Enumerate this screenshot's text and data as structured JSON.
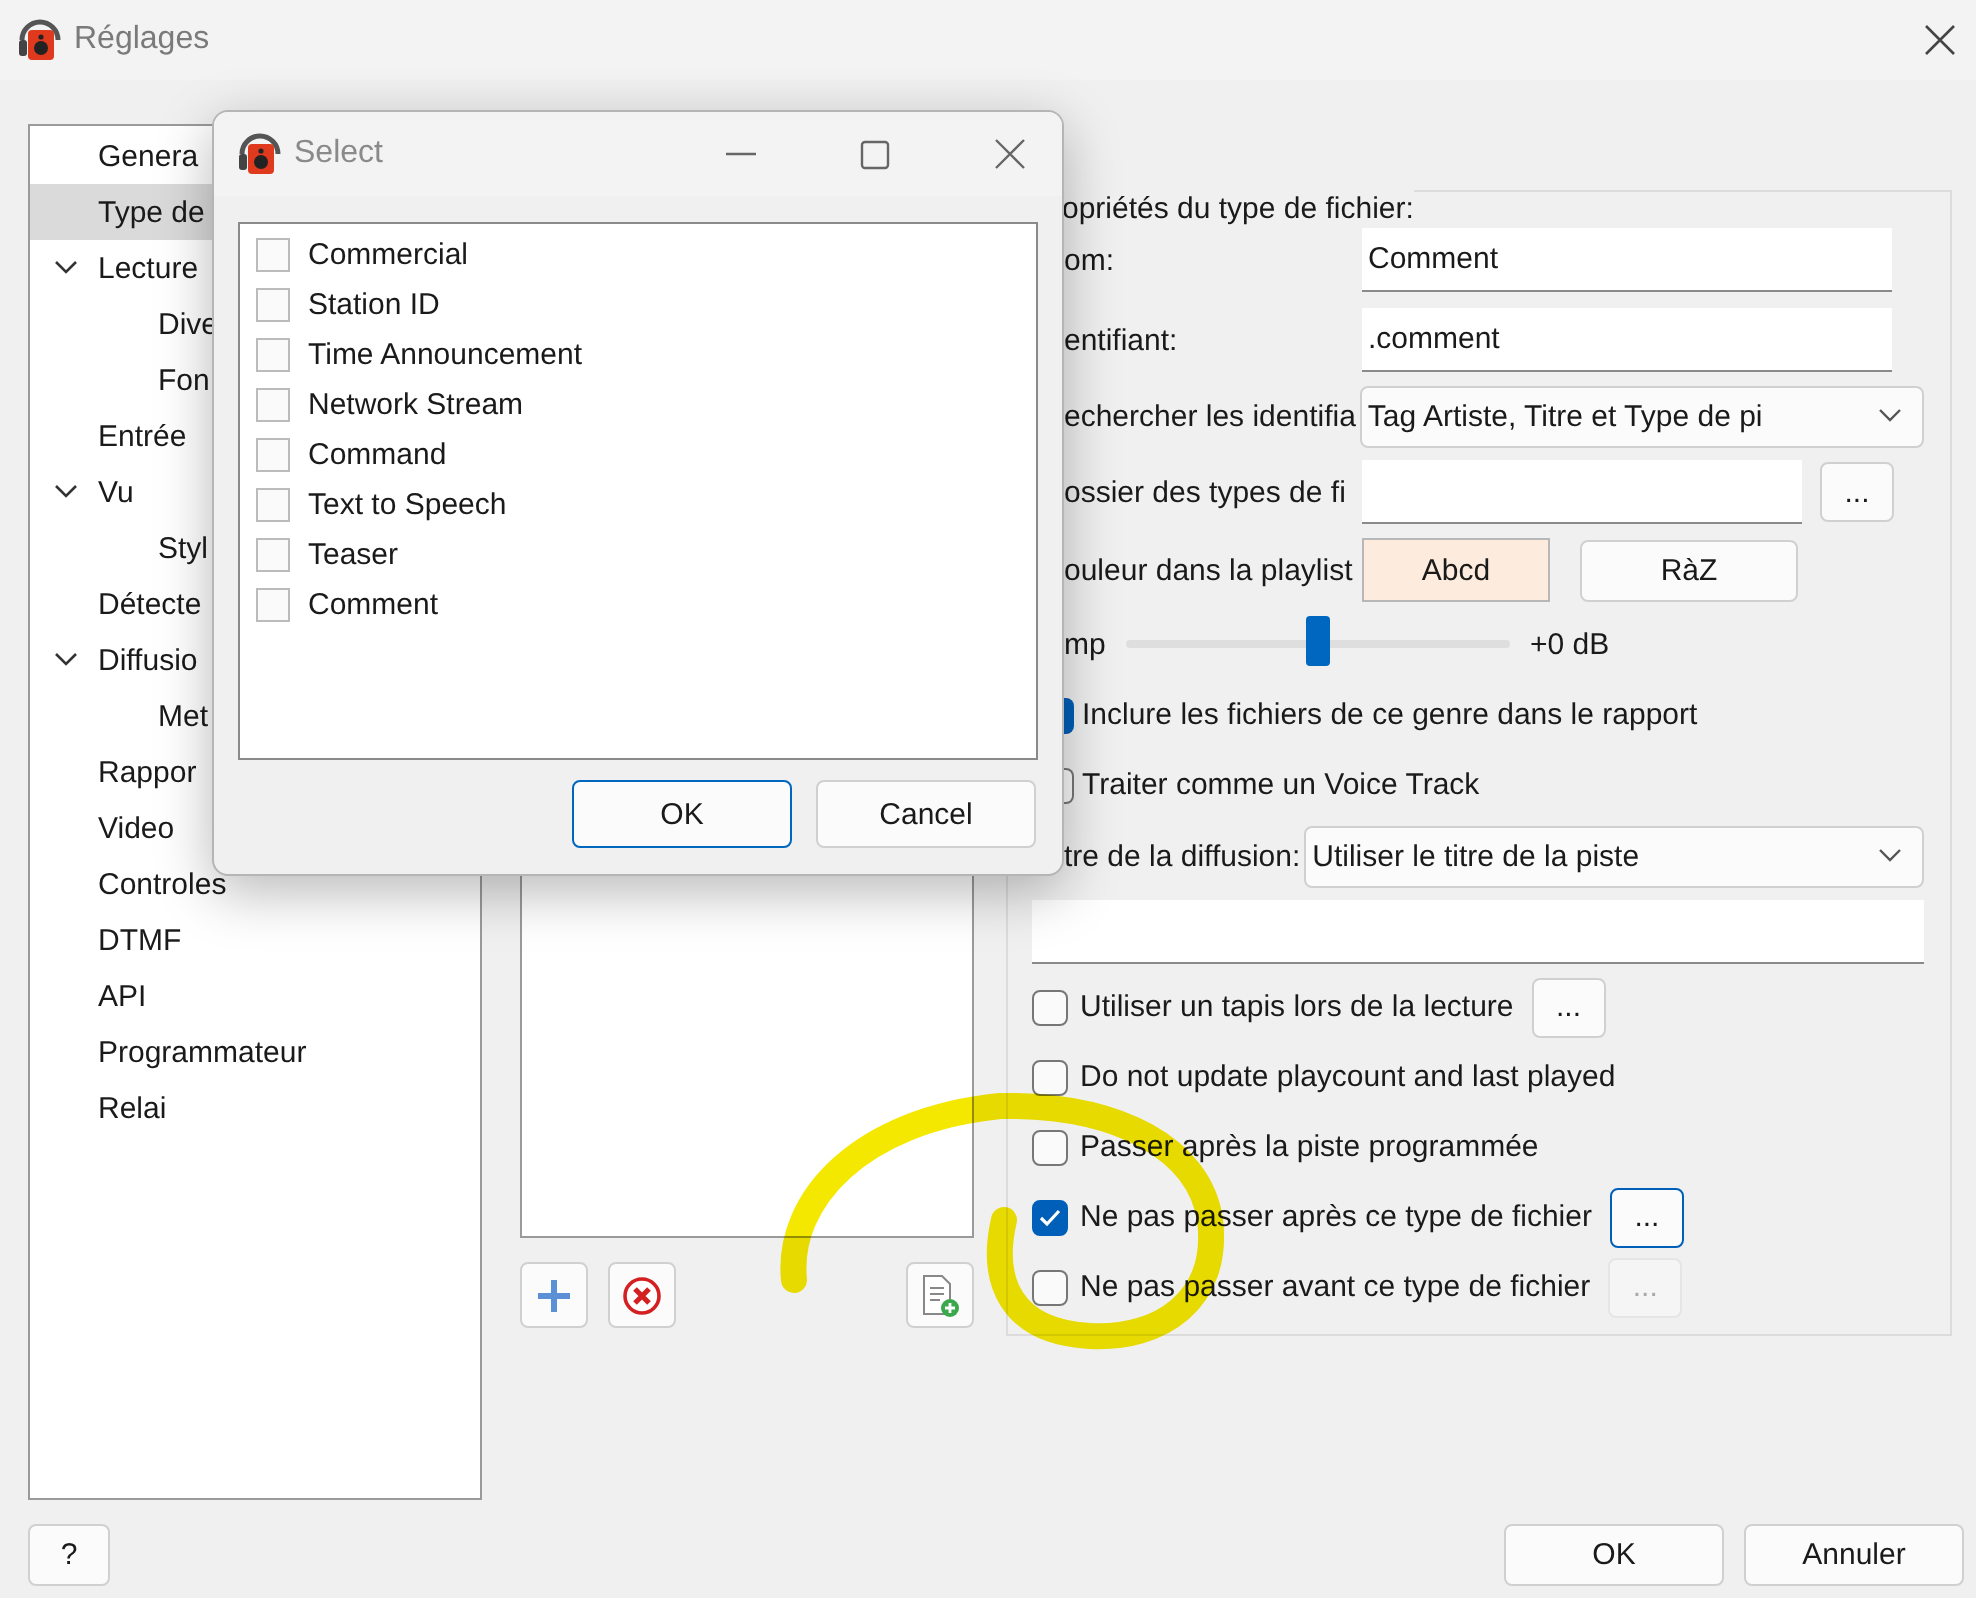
{
  "window": {
    "title": "Réglages"
  },
  "sidebar": {
    "items": [
      {
        "label": "Genera",
        "selected": false
      },
      {
        "label": "Type de",
        "selected": true
      },
      {
        "label": "Lecture",
        "selected": false,
        "expanded": true,
        "children": [
          {
            "label": "Dive",
            "selected": false
          },
          {
            "label": "Fon",
            "selected": false
          }
        ]
      },
      {
        "label": "Entrée",
        "selected": false
      },
      {
        "label": "Vu",
        "selected": false,
        "expanded": true,
        "children": [
          {
            "label": "Styl",
            "selected": false
          }
        ]
      },
      {
        "label": "Détecte",
        "selected": false
      },
      {
        "label": "Diffusio",
        "selected": false,
        "expanded": true,
        "children": [
          {
            "label": "Met",
            "selected": false
          }
        ]
      },
      {
        "label": "Rappor",
        "selected": false
      },
      {
        "label": "Video",
        "selected": false
      },
      {
        "label": "Controles",
        "selected": false
      },
      {
        "label": "DTMF",
        "selected": false
      },
      {
        "label": "API",
        "selected": false
      },
      {
        "label": "Programmateur",
        "selected": false
      },
      {
        "label": "Relai",
        "selected": false
      }
    ]
  },
  "properties": {
    "legend": "opriétés du type de fichier:",
    "rows": [
      {
        "kind": "text",
        "label": "om:",
        "value": "Comment"
      },
      {
        "kind": "text",
        "label": "entifiant:",
        "value": ".comment"
      },
      {
        "kind": "select",
        "label": "echercher les identifia",
        "value": "Tag Artiste, Titre et Type de pi"
      },
      {
        "kind": "browse",
        "label": "ossier des types de fi",
        "button": {
          "label": "...",
          "focused": false,
          "disabled": false
        }
      },
      {
        "kind": "color",
        "label": "ouleur dans la playlist",
        "swatch": "Abcd",
        "reset": "RàZ"
      },
      {
        "kind": "slider",
        "label": "mp",
        "level": 0.5,
        "reading": "+0 dB"
      },
      {
        "kind": "check",
        "label": "Inclure les fichiers de ce genre dans le rapport",
        "checked": true
      },
      {
        "kind": "check",
        "label": "Traiter comme un Voice Track",
        "checked": false
      },
      {
        "kind": "select",
        "label": "tre de la diffusion:",
        "value": "Utiliser le titre de la piste"
      },
      {
        "kind": "field"
      },
      {
        "kind": "check",
        "label": "Utiliser un tapis lors de la lecture",
        "checked": false,
        "button": {
          "label": "...",
          "focused": false,
          "disabled": false
        }
      },
      {
        "kind": "check",
        "label": "Do not update playcount and last played",
        "checked": false
      },
      {
        "kind": "check",
        "label": "Passer après la piste programmée",
        "checked": false
      },
      {
        "kind": "check",
        "label": "Ne pas passer après ce type de fichier",
        "checked": true,
        "button": {
          "label": "...",
          "focused": true,
          "disabled": false
        }
      },
      {
        "kind": "check",
        "label": "Ne pas passer avant ce type de fichier",
        "checked": false,
        "button": {
          "label": "...",
          "focused": false,
          "disabled": true
        }
      }
    ]
  },
  "dialog": {
    "title": "Select",
    "items": [
      {
        "label": "Commercial",
        "checked": false
      },
      {
        "label": "Station ID",
        "checked": false
      },
      {
        "label": "Time Announcement",
        "checked": false
      },
      {
        "label": "Network Stream",
        "checked": false
      },
      {
        "label": "Command",
        "checked": false
      },
      {
        "label": "Text to Speech",
        "checked": false
      },
      {
        "label": "Teaser",
        "checked": false
      },
      {
        "label": "Comment",
        "checked": false
      }
    ],
    "buttons": [
      {
        "label": "OK",
        "default": true
      },
      {
        "label": "Cancel",
        "default": false
      }
    ]
  },
  "footer": {
    "help": "?",
    "buttons": [
      "OK",
      "Annuler"
    ]
  }
}
